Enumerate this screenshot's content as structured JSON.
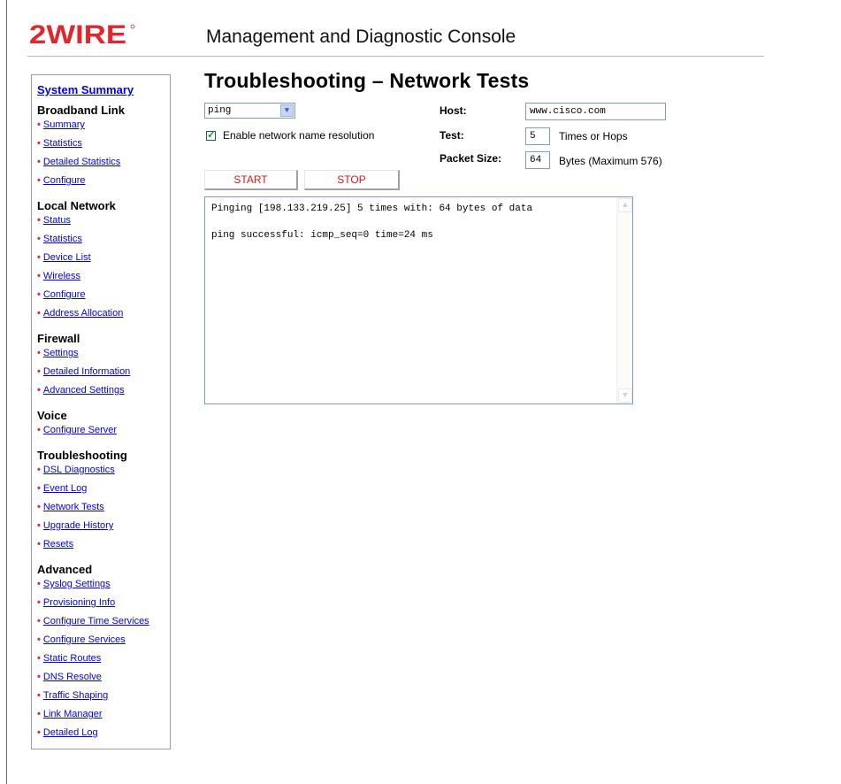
{
  "header": {
    "logo_text": "2WIRE",
    "console_title": "Management and Diagnostic Console"
  },
  "colors": {
    "logo_red": "#e2262b",
    "link_blue": "#0000ee",
    "button_text": "#d5171d"
  },
  "sidebar": {
    "summary_link": "System Summary",
    "sections": [
      {
        "heading": "Broadband Link",
        "items": [
          "Summary",
          "Statistics",
          "Detailed Statistics",
          "Configure"
        ]
      },
      {
        "heading": "Local Network",
        "items": [
          "Status",
          "Statistics",
          "Device List",
          "Wireless",
          "Configure",
          "Address Allocation"
        ]
      },
      {
        "heading": "Firewall",
        "items": [
          "Settings",
          "Detailed Information",
          "Advanced Settings"
        ]
      },
      {
        "heading": "Voice",
        "items": [
          "Configure Server"
        ]
      },
      {
        "heading": "Troubleshooting",
        "items": [
          "DSL Diagnostics",
          "Event Log",
          "Network Tests",
          "Upgrade History",
          "Resets"
        ]
      },
      {
        "heading": "Advanced",
        "items": [
          "Syslog Settings",
          "Provisioning Info",
          "Configure Time Services",
          "Configure Services",
          "Static Routes",
          "DNS Resolve",
          "Traffic Shaping",
          "Link Manager",
          "Detailed Log"
        ]
      }
    ]
  },
  "main": {
    "title": "Troubleshooting – Network Tests",
    "test_type": {
      "selected": "ping",
      "icon": "chevron-down-icon"
    },
    "name_resolution": {
      "label": "Enable network name resolution",
      "checked": true
    },
    "host": {
      "label": "Host:",
      "value": "www.cisco.com"
    },
    "test": {
      "label": "Test:",
      "value": "5",
      "suffix": "Times or Hops"
    },
    "packet_size": {
      "label": "Packet Size:",
      "value": "64",
      "suffix": "Bytes (Maximum 576)"
    },
    "buttons": {
      "start": "START",
      "stop": "STOP"
    },
    "output_lines": [
      "Pinging [198.133.219.25] 5 times with: 64 bytes of data",
      "ping successful: icmp_seq=0 time=24 ms"
    ]
  }
}
